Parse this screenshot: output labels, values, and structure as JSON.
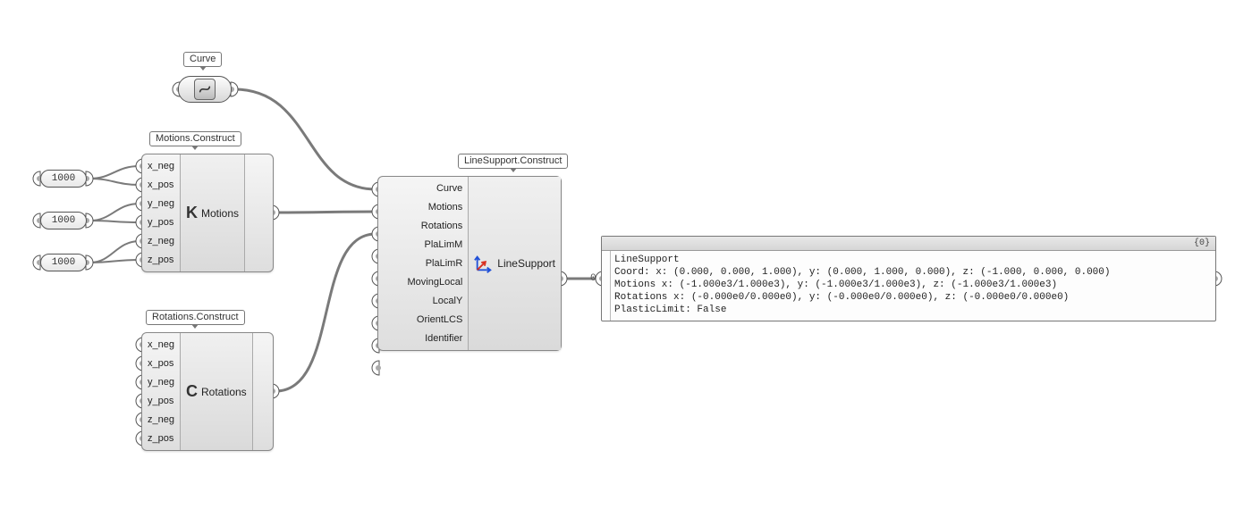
{
  "curve_param": {
    "label": "Curve"
  },
  "sliders": {
    "s1": "1000",
    "s2": "1000",
    "s3": "1000"
  },
  "motions_comp": {
    "label": "Motions.Construct",
    "nickname": "Motions",
    "glyph": "K",
    "inputs": [
      "x_neg",
      "x_pos",
      "y_neg",
      "y_pos",
      "z_neg",
      "z_pos"
    ]
  },
  "rotations_comp": {
    "label": "Rotations.Construct",
    "nickname": "Rotations",
    "glyph": "C",
    "inputs": [
      "x_neg",
      "x_pos",
      "y_neg",
      "y_pos",
      "z_neg",
      "z_pos"
    ]
  },
  "linesupport_comp": {
    "label": "LineSupport.Construct",
    "nickname": "LineSupport",
    "inputs": [
      "Curve",
      "Motions",
      "Rotations",
      "PlaLimM",
      "PlaLimR",
      "MovingLocal",
      "LocalY",
      "OrientLCS",
      "Identifier"
    ]
  },
  "panel": {
    "path_header": "{0}",
    "index": "0",
    "lines": [
      "LineSupport",
      "Coord: x: (0.000, 0.000, 1.000), y: (0.000, 1.000, 0.000), z: (-1.000, 0.000, 0.000)",
      "Motions x: (-1.000e3/1.000e3), y: (-1.000e3/1.000e3), z: (-1.000e3/1.000e3)",
      "Rotations x: (-0.000e0/0.000e0), y: (-0.000e0/0.000e0), z: (-0.000e0/0.000e0)",
      "PlasticLimit: False"
    ]
  }
}
